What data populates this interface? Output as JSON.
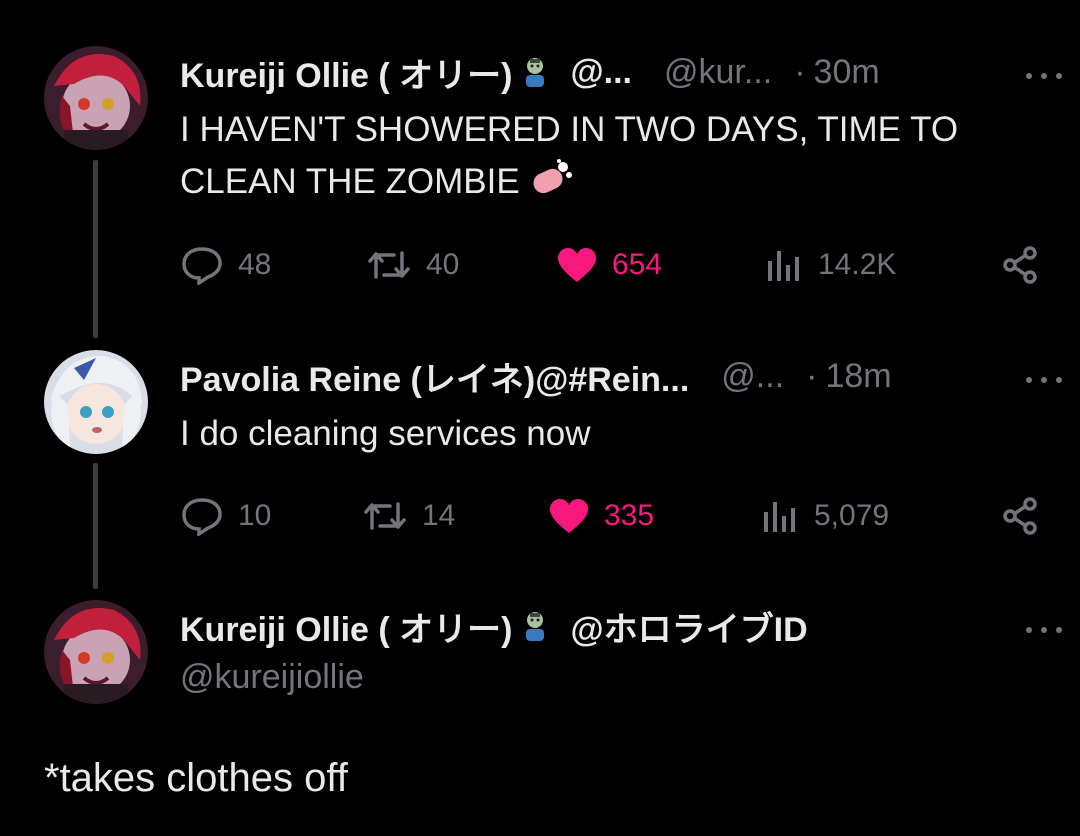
{
  "tweets": [
    {
      "display_name": "Kureiji Ollie ( オリー) ",
      "handle_truncated": "@...",
      "handle": "@kur...",
      "dot": "·",
      "time": "30m",
      "text_line1": "I HAVEN'T SHOWERED IN TWO DAYS, TIME TO",
      "text_line2": "CLEAN THE ZOMBIE",
      "emoji_icon": "soap-icon",
      "replies": "48",
      "retweets": "40",
      "likes": "654",
      "views": "14.2K"
    },
    {
      "display_name": "Pavolia Reine (レイネ)@#Rein...",
      "handle": "@...",
      "dot": "·",
      "time": "18m",
      "text": "I do cleaning services now",
      "replies": "10",
      "retweets": "14",
      "likes": "335",
      "views": "5,079"
    },
    {
      "display_name": "Kureiji Ollie ( オリー) ",
      "display_suffix": "@ホロライブID",
      "handle": "@kureijiollie",
      "text": "*takes clothes off"
    }
  ],
  "colors": {
    "background": "#000000",
    "text": "#e7e9ea",
    "muted": "#71767b",
    "like": "#f91880",
    "thread_line": "#3a3d41"
  }
}
